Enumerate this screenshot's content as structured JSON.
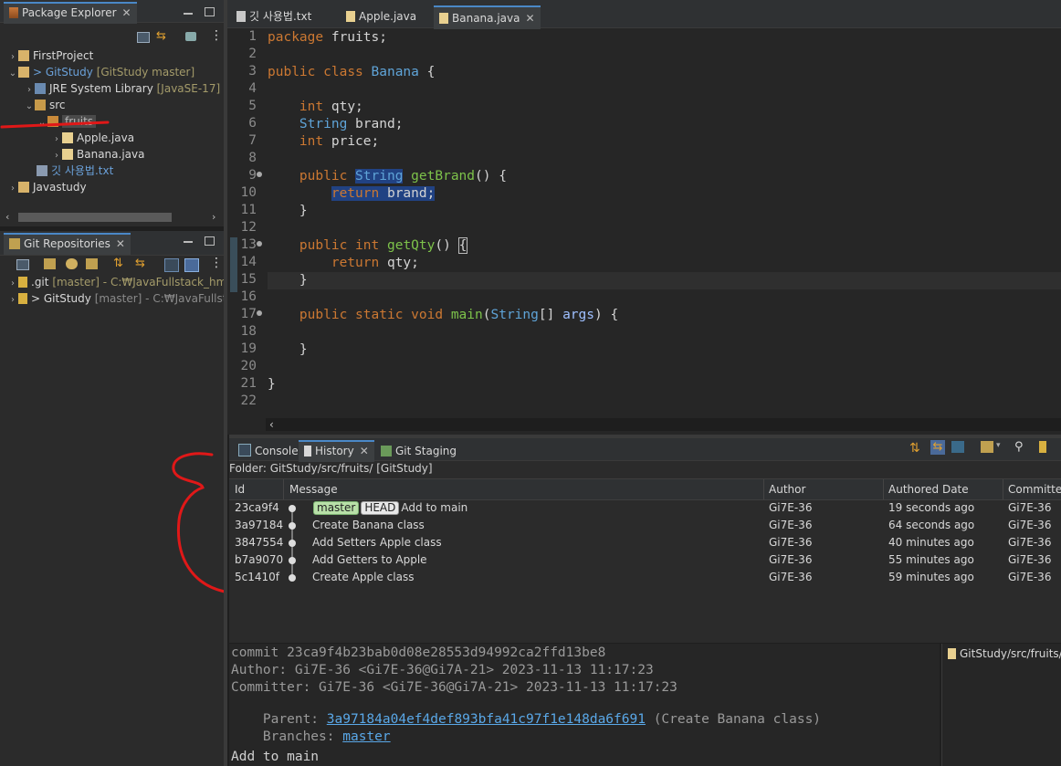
{
  "package_explorer": {
    "title": "Package Explorer",
    "items": [
      {
        "label": "FirstProject",
        "extra": ""
      },
      {
        "label": "> GitStudy",
        "extra": "[GitStudy master]"
      },
      {
        "label": "JRE System Library",
        "extra": "[JavaSE-17]"
      },
      {
        "label": "src",
        "extra": ""
      },
      {
        "label": "fruits",
        "extra": ""
      },
      {
        "label": "Apple.java",
        "extra": ""
      },
      {
        "label": "Banana.java",
        "extra": ""
      },
      {
        "label": "깃 사용법.txt",
        "extra": ""
      },
      {
        "label": "Javastudy",
        "extra": ""
      }
    ]
  },
  "git_repositories": {
    "title": "Git Repositories",
    "items": [
      {
        "label": ".git",
        "extra": "[master] - C:₩JavaFullstack_hm₩"
      },
      {
        "label": "> GitStudy",
        "extra": "[master] - C:₩JavaFullstac"
      }
    ]
  },
  "editor": {
    "tabs": [
      "깃 사용법.txt",
      "Apple.java",
      "Banana.java"
    ],
    "active_tab": "Banana.java",
    "line_numbers": [
      "1",
      "2",
      "3",
      "4",
      "5",
      "6",
      "7",
      "8",
      "9",
      "10",
      "11",
      "12",
      "13",
      "14",
      "15",
      "16",
      "17",
      "18",
      "19",
      "20",
      "21",
      "22"
    ],
    "code": {
      "l1a": "package",
      "l1b": " fruits;",
      "l3a": "public",
      "l3b": "class",
      "l3c": "Banana",
      "l3d": " {",
      "l5a": "int",
      "l5b": " qty;",
      "l6a": "String",
      "l6b": " brand;",
      "l7a": "int",
      "l7b": " price;",
      "l9a": "public",
      "l9b": "String",
      "l9c": "getBrand",
      "l9d": "() {",
      "l10a": "return",
      "l10b": " brand;",
      "l11": "}",
      "l13a": "public",
      "l13b": "int",
      "l13c": "getQty",
      "l13d": "() ",
      "l13e": "{",
      "l14a": "return",
      "l14b": " qty;",
      "l15": "}",
      "l17a": "public",
      "l17b": "static",
      "l17c": "void",
      "l17d": "main",
      "l17e": "(",
      "l17f": "String",
      "l17g": "[] ",
      "l17h": "args",
      "l17i": ") {",
      "l19": "}",
      "l21": "}"
    }
  },
  "bottom": {
    "tabs": [
      "Console",
      "History",
      "Git Staging"
    ],
    "active_tab": "History",
    "folder_label": "Folder: GitStudy/src/fruits/ [GitStudy]",
    "columns": [
      "Id",
      "Message",
      "Author",
      "Authored Date",
      "Committer"
    ],
    "rows": [
      {
        "id": "23ca9f4",
        "badges": [
          "master",
          "HEAD"
        ],
        "message": "Add to main",
        "author": "Gi7E-36",
        "date": "19 seconds ago",
        "committer": "Gi7E-36"
      },
      {
        "id": "3a97184",
        "badges": [],
        "message": "Create Banana class",
        "author": "Gi7E-36",
        "date": "64 seconds ago",
        "committer": "Gi7E-36"
      },
      {
        "id": "3847554",
        "badges": [],
        "message": "Add Setters Apple class",
        "author": "Gi7E-36",
        "date": "40 minutes ago",
        "committer": "Gi7E-36"
      },
      {
        "id": "b7a9070",
        "badges": [],
        "message": "Add Getters to Apple",
        "author": "Gi7E-36",
        "date": "55 minutes ago",
        "committer": "Gi7E-36"
      },
      {
        "id": "5c1410f",
        "badges": [],
        "message": "Create Apple class",
        "author": "Gi7E-36",
        "date": "59 minutes ago",
        "committer": "Gi7E-36"
      }
    ],
    "commit_details": {
      "commit": "commit 23ca9f4b23bab0d08e28553d94992ca2ffd13be8",
      "author": "Author: Gi7E-36 <Gi7E-36@Gi7A-21> 2023-11-13 11:17:23",
      "committer": "Committer: Gi7E-36 <Gi7E-36@Gi7A-21> 2023-11-13 11:17:23",
      "parent_label": "Parent: ",
      "parent_hash": "3a97184a04ef4def893bfa41c97f1e148da6f691",
      "parent_msg": " (Create Banana class)",
      "branches_label": "Branches: ",
      "branch": "master",
      "message": "Add to main"
    },
    "file_panel": "GitStudy/src/fruits/B"
  }
}
